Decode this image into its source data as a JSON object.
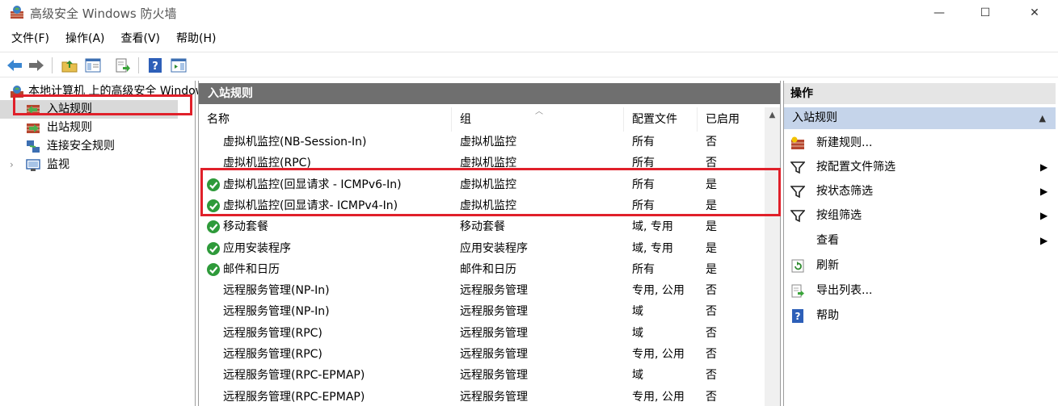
{
  "window": {
    "title": "高级安全 Windows 防火墙",
    "minimize_glyph": "—",
    "maximize_glyph": "☐",
    "close_glyph": "✕"
  },
  "menu": [
    "文件(F)",
    "操作(A)",
    "查看(V)",
    "帮助(H)"
  ],
  "tree": {
    "root_label": "本地计算机 上的高级安全 Windows",
    "items": [
      {
        "label": "入站规则"
      },
      {
        "label": "出站规则"
      },
      {
        "label": "连接安全规则"
      },
      {
        "label": "监视"
      }
    ]
  },
  "center": {
    "header": "入站规则",
    "columns": [
      "名称",
      "组",
      "配置文件",
      "已启用"
    ],
    "rows": [
      {
        "enabled_icon": false,
        "name": "虚拟机监控(NB-Session-In)",
        "group": "虚拟机监控",
        "profile": "所有",
        "enabled": "否"
      },
      {
        "enabled_icon": false,
        "name": "虚拟机监控(RPC)",
        "group": "虚拟机监控",
        "profile": "所有",
        "enabled": "否"
      },
      {
        "enabled_icon": true,
        "name": "虚拟机监控(回显请求 - ICMPv6-In)",
        "group": "虚拟机监控",
        "profile": "所有",
        "enabled": "是"
      },
      {
        "enabled_icon": true,
        "name": "虚拟机监控(回显请求- ICMPv4-In)",
        "group": "虚拟机监控",
        "profile": "所有",
        "enabled": "是"
      },
      {
        "enabled_icon": true,
        "name": "移动套餐",
        "group": "移动套餐",
        "profile": "域, 专用",
        "enabled": "是"
      },
      {
        "enabled_icon": true,
        "name": "应用安装程序",
        "group": "应用安装程序",
        "profile": "域, 专用",
        "enabled": "是"
      },
      {
        "enabled_icon": true,
        "name": "邮件和日历",
        "group": "邮件和日历",
        "profile": "所有",
        "enabled": "是"
      },
      {
        "enabled_icon": false,
        "name": "远程服务管理(NP-In)",
        "group": "远程服务管理",
        "profile": "专用, 公用",
        "enabled": "否"
      },
      {
        "enabled_icon": false,
        "name": "远程服务管理(NP-In)",
        "group": "远程服务管理",
        "profile": "域",
        "enabled": "否"
      },
      {
        "enabled_icon": false,
        "name": "远程服务管理(RPC)",
        "group": "远程服务管理",
        "profile": "域",
        "enabled": "否"
      },
      {
        "enabled_icon": false,
        "name": "远程服务管理(RPC)",
        "group": "远程服务管理",
        "profile": "专用, 公用",
        "enabled": "否"
      },
      {
        "enabled_icon": false,
        "name": "远程服务管理(RPC-EPMAP)",
        "group": "远程服务管理",
        "profile": "域",
        "enabled": "否"
      },
      {
        "enabled_icon": false,
        "name": "远程服务管理(RPC-EPMAP)",
        "group": "远程服务管理",
        "profile": "专用, 公用",
        "enabled": "否"
      }
    ]
  },
  "actions": {
    "header": "操作",
    "section": "入站规则",
    "items": [
      {
        "label": "新建规则...",
        "icon": "new-rule-icon",
        "submenu": false
      },
      {
        "label": "按配置文件筛选",
        "icon": "filter-icon",
        "submenu": true
      },
      {
        "label": "按状态筛选",
        "icon": "filter-icon",
        "submenu": true
      },
      {
        "label": "按组筛选",
        "icon": "filter-icon",
        "submenu": true
      },
      {
        "label": "查看",
        "icon": "",
        "submenu": true
      },
      {
        "label": "刷新",
        "icon": "refresh-icon",
        "submenu": false
      },
      {
        "label": "导出列表...",
        "icon": "export-list-icon",
        "submenu": false
      },
      {
        "label": "帮助",
        "icon": "help-icon",
        "submenu": false
      }
    ]
  },
  "colors": {
    "center_header_bg": "#6f6f6f",
    "actions_section_bg": "#c5d4ea",
    "annotation_red": "#e0202a",
    "enabled_check_green": "#2e9a3a"
  }
}
